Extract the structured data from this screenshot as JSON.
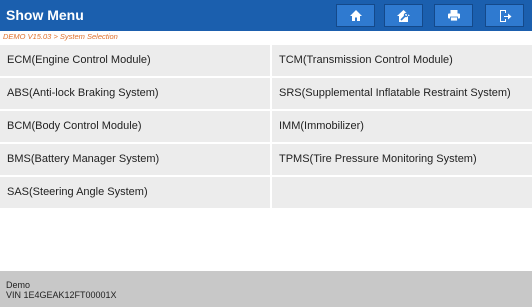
{
  "header": {
    "title": "Show Menu",
    "buttons": [
      {
        "name": "home-button",
        "icon": "home-icon"
      },
      {
        "name": "special-functions-button",
        "icon": "house-wrench-icon"
      },
      {
        "name": "print-button",
        "icon": "printer-icon"
      },
      {
        "name": "exit-button",
        "icon": "exit-icon"
      }
    ],
    "bg_color": "#1b5fae",
    "button_color": "#2f7ad0"
  },
  "breadcrumb": "DEMO V15.03 > System Selection",
  "systems": [
    {
      "label": "ECM(Engine Control Module)"
    },
    {
      "label": "TCM(Transmission Control Module)"
    },
    {
      "label": "ABS(Anti-lock Braking System)"
    },
    {
      "label": "SRS(Supplemental Inflatable Restraint System)"
    },
    {
      "label": "BCM(Body Control Module)"
    },
    {
      "label": "IMM(Immobilizer)"
    },
    {
      "label": "BMS(Battery Manager System)"
    },
    {
      "label": "TPMS(Tire Pressure Monitoring System)"
    },
    {
      "label": "SAS(Steering Angle System)"
    },
    {
      "label": ""
    }
  ],
  "footer": {
    "line1": "Demo",
    "line2": "VIN 1E4GEAK12FT00001X"
  },
  "colors": {
    "breadcrumb": "#e0702a",
    "cell_bg": "#ececec",
    "footer_bg": "#c8c8c8"
  }
}
